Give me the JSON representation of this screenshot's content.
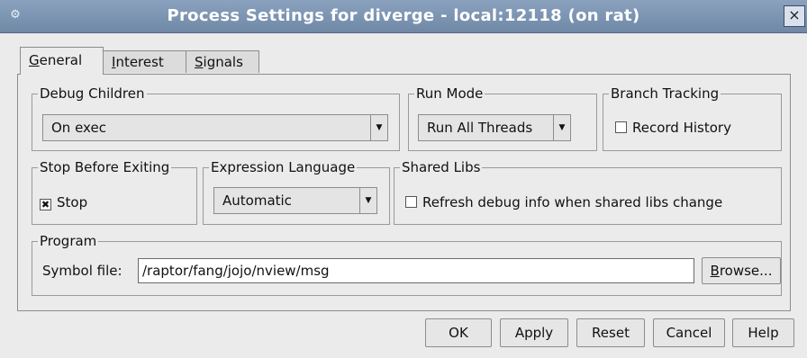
{
  "window": {
    "title": "Process Settings for diverge - local:12118 (on rat)",
    "close_glyph": "×",
    "icon": "tv-icon"
  },
  "tabs": [
    {
      "mnemonic": "G",
      "rest": "eneral"
    },
    {
      "mnemonic": "I",
      "rest": "nterest"
    },
    {
      "mnemonic": "S",
      "rest": "ignals"
    }
  ],
  "debug_children": {
    "label": "Debug Children",
    "value": "On exec"
  },
  "run_mode": {
    "label": "Run Mode",
    "value": "Run All Threads"
  },
  "branch_tracking": {
    "label": "Branch Tracking",
    "checkbox_label": "Record History",
    "checked": false
  },
  "stop_before_exiting": {
    "label": "Stop Before Exiting",
    "checkbox_label": "Stop",
    "checked": true
  },
  "expression_language": {
    "label": "Expression Language",
    "value": "Automatic"
  },
  "shared_libs": {
    "label": "Shared Libs",
    "checkbox_label": "Refresh debug info when shared libs change",
    "checked": false
  },
  "program": {
    "label": "Program",
    "symbol_file_label": "Symbol file:",
    "symbol_file_value": "/raptor/fang/jojo/nview/msg",
    "browse_mnemonic": "B",
    "browse_rest": "rowse..."
  },
  "buttons": {
    "ok": "OK",
    "apply": "Apply",
    "reset": "Reset",
    "cancel": "Cancel",
    "help": "Help"
  }
}
